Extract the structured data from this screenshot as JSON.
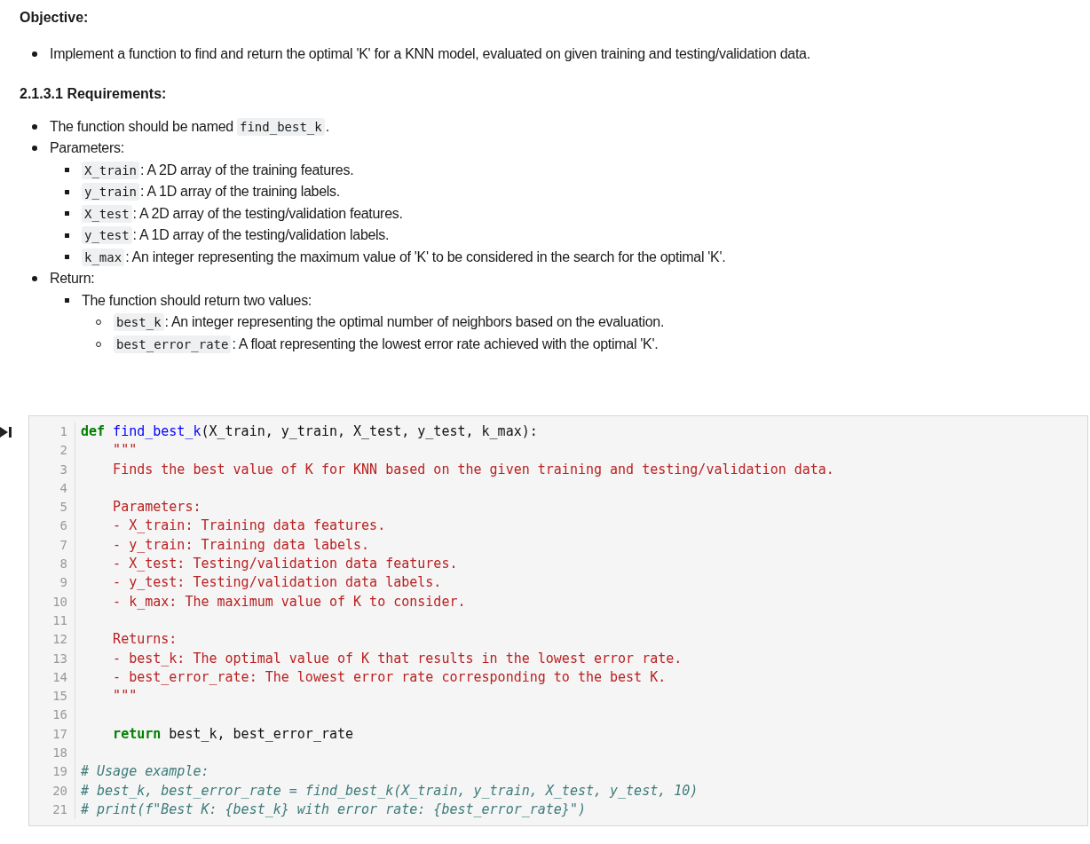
{
  "objective": {
    "title": "Objective:",
    "items": [
      {
        "parts": [
          {
            "kind": "text",
            "text": "Implement a function to find and return the optimal 'K' for a KNN model, evaluated on given training and testing/validation data."
          }
        ]
      }
    ]
  },
  "requirements": {
    "title": "2.1.3.1 Requirements:",
    "items": [
      {
        "parts": [
          {
            "kind": "text",
            "text": "The function should be named "
          },
          {
            "kind": "code",
            "text": "find_best_k"
          },
          {
            "kind": "text",
            "text": "."
          }
        ]
      },
      {
        "parts": [
          {
            "kind": "text",
            "text": "Parameters:"
          }
        ],
        "children": [
          {
            "parts": [
              {
                "kind": "code",
                "text": "X_train"
              },
              {
                "kind": "text",
                "text": ": A 2D array of the training features."
              }
            ]
          },
          {
            "parts": [
              {
                "kind": "code",
                "text": "y_train"
              },
              {
                "kind": "text",
                "text": ": A 1D array of the training labels."
              }
            ]
          },
          {
            "parts": [
              {
                "kind": "code",
                "text": "X_test"
              },
              {
                "kind": "text",
                "text": ": A 2D array of the testing/validation features."
              }
            ]
          },
          {
            "parts": [
              {
                "kind": "code",
                "text": "y_test"
              },
              {
                "kind": "text",
                "text": ": A 1D array of the testing/validation labels."
              }
            ]
          },
          {
            "parts": [
              {
                "kind": "code",
                "text": "k_max"
              },
              {
                "kind": "text",
                "text": ": An integer representing the maximum value of 'K' to be considered in the search for the optimal 'K'."
              }
            ]
          }
        ]
      },
      {
        "parts": [
          {
            "kind": "text",
            "text": "Return:"
          }
        ],
        "children": [
          {
            "parts": [
              {
                "kind": "text",
                "text": "The function should return two values:"
              }
            ],
            "children": [
              {
                "parts": [
                  {
                    "kind": "code",
                    "text": "best_k"
                  },
                  {
                    "kind": "text",
                    "text": ": An integer representing the optimal number of neighbors based on the evaluation."
                  }
                ]
              },
              {
                "parts": [
                  {
                    "kind": "code",
                    "text": "best_error_rate"
                  },
                  {
                    "kind": "text",
                    "text": ": A float representing the lowest error rate achieved with the optimal 'K'."
                  }
                ]
              }
            ]
          }
        ]
      }
    ]
  },
  "code_cell": {
    "lines": [
      {
        "number": "1",
        "tokens": [
          {
            "kind": "keyword",
            "text": "def"
          },
          {
            "kind": "function",
            "text": " find_best_k"
          },
          {
            "kind": "plain",
            "text": "(X_train, y_train, X_test, y_test, k_max):"
          }
        ]
      },
      {
        "number": "2",
        "tokens": [
          {
            "kind": "string",
            "text": "    \"\"\""
          }
        ]
      },
      {
        "number": "3",
        "tokens": [
          {
            "kind": "string",
            "text": "    Finds the best value of K for KNN based on the given training and testing/validation data."
          }
        ]
      },
      {
        "number": "4"
      },
      {
        "number": "5",
        "tokens": [
          {
            "kind": "string",
            "text": "    Parameters:"
          }
        ]
      },
      {
        "number": "6",
        "tokens": [
          {
            "kind": "string",
            "text": "    - X_train: Training data features."
          }
        ]
      },
      {
        "number": "7",
        "tokens": [
          {
            "kind": "string",
            "text": "    - y_train: Training data labels."
          }
        ]
      },
      {
        "number": "8",
        "tokens": [
          {
            "kind": "string",
            "text": "    - X_test: Testing/validation data features."
          }
        ]
      },
      {
        "number": "9",
        "tokens": [
          {
            "kind": "string",
            "text": "    - y_test: Testing/validation data labels."
          }
        ]
      },
      {
        "number": "10",
        "tokens": [
          {
            "kind": "string",
            "text": "    - k_max: The maximum value of K to consider."
          }
        ]
      },
      {
        "number": "11"
      },
      {
        "number": "12",
        "tokens": [
          {
            "kind": "string",
            "text": "    Returns:"
          }
        ]
      },
      {
        "number": "13",
        "tokens": [
          {
            "kind": "string",
            "text": "    - best_k: The optimal value of K that results in the lowest error rate."
          }
        ]
      },
      {
        "number": "14",
        "tokens": [
          {
            "kind": "string",
            "text": "    - best_error_rate: The lowest error rate corresponding to the best K."
          }
        ]
      },
      {
        "number": "15",
        "tokens": [
          {
            "kind": "string",
            "text": "    \"\"\""
          }
        ]
      },
      {
        "number": "16"
      },
      {
        "number": "17",
        "tokens": [
          {
            "kind": "keyword",
            "text": "    return"
          },
          {
            "kind": "plain",
            "text": " best_k, best_error_rate"
          }
        ]
      },
      {
        "number": "18"
      },
      {
        "number": "19",
        "tokens": [
          {
            "kind": "comment",
            "text": "# Usage example:"
          }
        ]
      },
      {
        "number": "20",
        "tokens": [
          {
            "kind": "comment",
            "text": "# best_k, best_error_rate = find_best_k(X_train, y_train, X_test, y_test, 10)"
          }
        ]
      },
      {
        "number": "21",
        "tokens": [
          {
            "kind": "comment",
            "text": "# print(f\"Best K: {best_k} with error rate: {best_error_rate}\")"
          }
        ]
      }
    ]
  }
}
